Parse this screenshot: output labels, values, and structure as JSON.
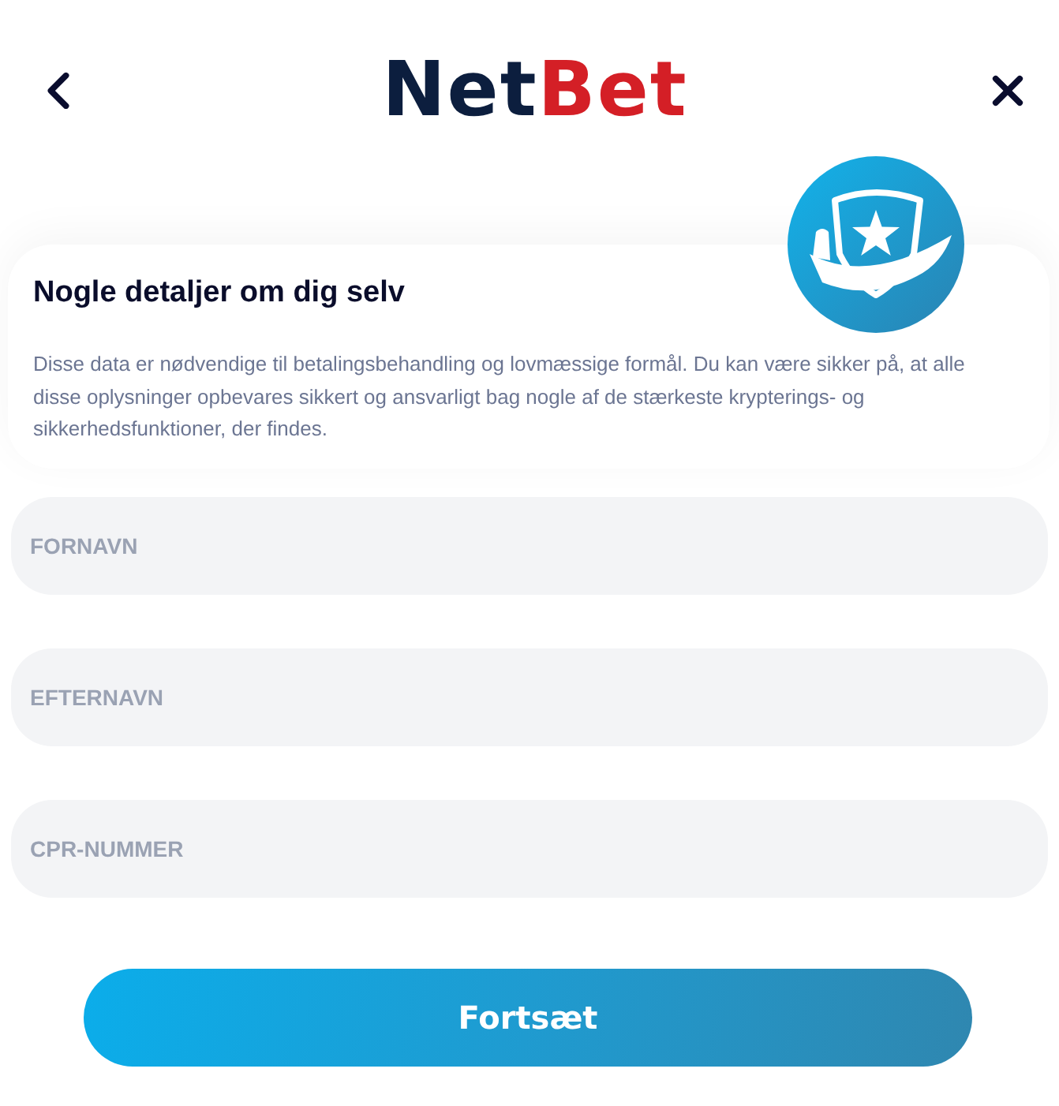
{
  "logo": {
    "parts": [
      "Net",
      "Bet"
    ]
  },
  "intro": {
    "title": "Nogle detaljer om dig selv",
    "text": "Disse data er nødvendige til betalingsbehandling og lovmæssige formål. Du kan være sikker på, at alle disse oplysninger opbevares sikkert og ansvarligt bag nogle af de stærkeste krypterings- og sikkerhedsfunktioner, der findes."
  },
  "fields": [
    {
      "placeholder": "FORNAVN"
    },
    {
      "placeholder": "EFTERNAVN"
    },
    {
      "placeholder": "CPR-NUMMER"
    }
  ],
  "submit": {
    "label": "Fortsæt"
  }
}
